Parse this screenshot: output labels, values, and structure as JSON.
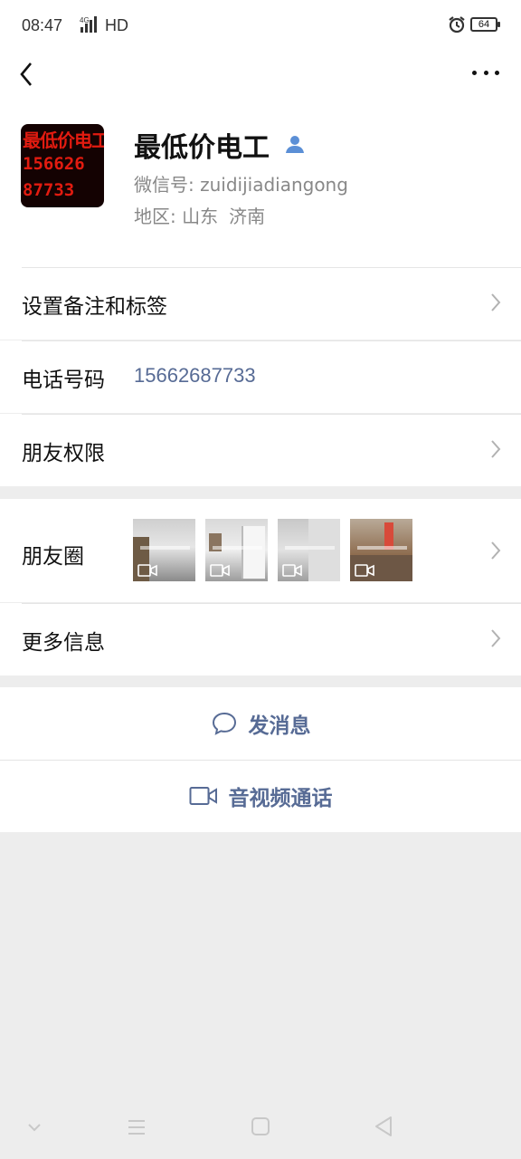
{
  "status_bar": {
    "time": "08:47",
    "network": "4G",
    "hd": "HD",
    "battery": "64"
  },
  "profile": {
    "avatar_lines": [
      "最低价电工",
      "156626",
      "87733"
    ],
    "name": "最低价电工",
    "wechat_id": "微信号: zuidijiadiangong",
    "region_label": "地区: 山东",
    "region_city": "济南"
  },
  "rows": {
    "remark": "设置备注和标签",
    "phone_label": "电话号码",
    "phone_value": "15662687733",
    "permissions": "朋友权限",
    "moments": "朋友圈",
    "more_info": "更多信息"
  },
  "actions": {
    "message": "发消息",
    "call": "音视频通话"
  },
  "colors": {
    "link_blue": "#576b95",
    "background": "#ededed"
  }
}
